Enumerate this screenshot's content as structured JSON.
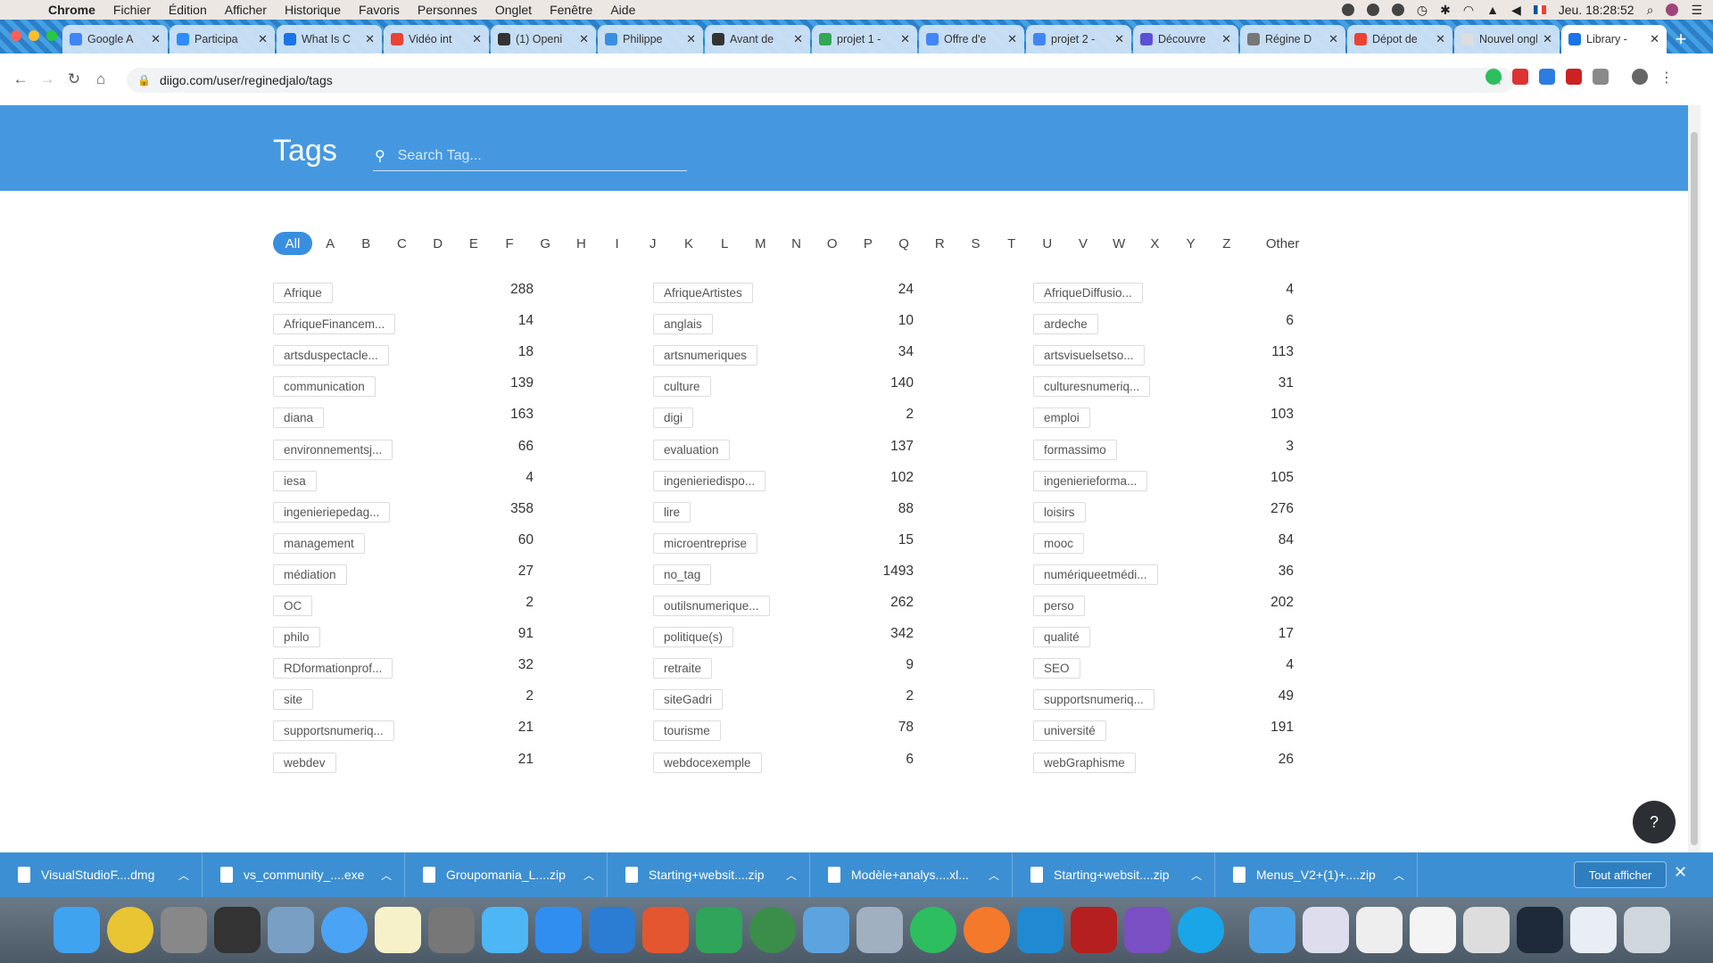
{
  "menubar": {
    "app": "Chrome",
    "items": [
      "Fichier",
      "Édition",
      "Afficher",
      "Historique",
      "Favoris",
      "Personnes",
      "Onglet",
      "Fenêtre",
      "Aide"
    ],
    "clock": "Jeu. 18:28:52"
  },
  "tabs": [
    {
      "title": "Google A",
      "color": "#4285f4"
    },
    {
      "title": "Participa",
      "color": "#2d8cff"
    },
    {
      "title": "What Is C",
      "color": "#1a73e8"
    },
    {
      "title": "Vidéo int",
      "color": "#ea4335"
    },
    {
      "title": "(1) Openi",
      "color": "#333333"
    },
    {
      "title": "Philippe",
      "color": "#3a8ee0"
    },
    {
      "title": "Avant de",
      "color": "#333333"
    },
    {
      "title": "projet 1 -",
      "color": "#34a853"
    },
    {
      "title": "Offre d'e",
      "color": "#4285f4"
    },
    {
      "title": "projet 2 -",
      "color": "#4285f4"
    },
    {
      "title": "Découvre",
      "color": "#5b4fd6"
    },
    {
      "title": "Régine D",
      "color": "#777777"
    },
    {
      "title": "Dépot de",
      "color": "#ea4335"
    },
    {
      "title": "Nouvel ongle",
      "color": "#dddddd"
    },
    {
      "title": "Library -",
      "color": "#1a73e8"
    }
  ],
  "url": "diigo.com/user/reginedjalo/tags",
  "page": {
    "title": "Tags",
    "search_placeholder": "Search Tag..."
  },
  "letters": [
    "All",
    "A",
    "B",
    "C",
    "D",
    "E",
    "F",
    "G",
    "H",
    "I",
    "J",
    "K",
    "L",
    "M",
    "N",
    "O",
    "P",
    "Q",
    "R",
    "S",
    "T",
    "U",
    "V",
    "W",
    "X",
    "Y",
    "Z",
    "Other"
  ],
  "tags": [
    [
      {
        "name": "Afrique",
        "count": "288"
      },
      {
        "name": "AfriqueArtistes",
        "count": "24"
      },
      {
        "name": "AfriqueDiffusio...",
        "count": "4"
      }
    ],
    [
      {
        "name": "AfriqueFinancem...",
        "count": "14"
      },
      {
        "name": "anglais",
        "count": "10"
      },
      {
        "name": "ardeche",
        "count": "6"
      }
    ],
    [
      {
        "name": "artsduspectacle...",
        "count": "18"
      },
      {
        "name": "artsnumeriques",
        "count": "34"
      },
      {
        "name": "artsvisuelsetso...",
        "count": "113"
      }
    ],
    [
      {
        "name": "communication",
        "count": "139"
      },
      {
        "name": "culture",
        "count": "140"
      },
      {
        "name": "culturesnumeriq...",
        "count": "31"
      }
    ],
    [
      {
        "name": "diana",
        "count": "163"
      },
      {
        "name": "digi",
        "count": "2"
      },
      {
        "name": "emploi",
        "count": "103"
      }
    ],
    [
      {
        "name": "environnementsj...",
        "count": "66"
      },
      {
        "name": "evaluation",
        "count": "137"
      },
      {
        "name": "formassimo",
        "count": "3"
      }
    ],
    [
      {
        "name": "iesa",
        "count": "4"
      },
      {
        "name": "ingenieriedispo...",
        "count": "102"
      },
      {
        "name": "ingenierieforma...",
        "count": "105"
      }
    ],
    [
      {
        "name": "ingenieriepedag...",
        "count": "358"
      },
      {
        "name": "lire",
        "count": "88"
      },
      {
        "name": "loisirs",
        "count": "276"
      }
    ],
    [
      {
        "name": "management",
        "count": "60"
      },
      {
        "name": "microentreprise",
        "count": "15"
      },
      {
        "name": "mooc",
        "count": "84"
      }
    ],
    [
      {
        "name": "médiation",
        "count": "27"
      },
      {
        "name": "no_tag",
        "count": "1493"
      },
      {
        "name": "numériqueetmédi...",
        "count": "36"
      }
    ],
    [
      {
        "name": "OC",
        "count": "2"
      },
      {
        "name": "outilsnumerique...",
        "count": "262"
      },
      {
        "name": "perso",
        "count": "202"
      }
    ],
    [
      {
        "name": "philo",
        "count": "91"
      },
      {
        "name": "politique(s)",
        "count": "342"
      },
      {
        "name": "qualité",
        "count": "17"
      }
    ],
    [
      {
        "name": "RDformationprof...",
        "count": "32"
      },
      {
        "name": "retraite",
        "count": "9"
      },
      {
        "name": "SEO",
        "count": "4"
      }
    ],
    [
      {
        "name": "site",
        "count": "2"
      },
      {
        "name": "siteGadri",
        "count": "2"
      },
      {
        "name": "supportsnumeriq...",
        "count": "49"
      }
    ],
    [
      {
        "name": "supportsnumeriq...",
        "count": "21"
      },
      {
        "name": "tourisme",
        "count": "78"
      },
      {
        "name": "université",
        "count": "191"
      }
    ],
    [
      {
        "name": "webdev",
        "count": "21"
      },
      {
        "name": "webdocexemple",
        "count": "6"
      },
      {
        "name": "webGraphisme",
        "count": "26"
      }
    ]
  ],
  "downloads": [
    "VisualStudioF....dmg",
    "vs_community_....exe",
    "Groupomania_L....zip",
    "Starting+websit....zip",
    "Modèle+analys....xl...",
    "Starting+websit....zip",
    "Menus_V2+(1)+....zip"
  ],
  "downloads_show_all": "Tout afficher",
  "colors": {
    "hero": "#4598e0",
    "accent": "#3a8ee0",
    "downloads_bar": "#3d8fd3"
  }
}
